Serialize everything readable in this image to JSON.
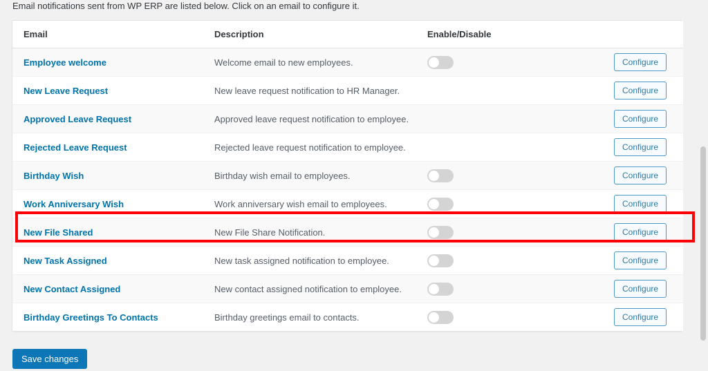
{
  "intro": {
    "text": "Email notifications sent from WP ERP are listed below. Click on an email to configure it."
  },
  "table": {
    "headers": {
      "email": "Email",
      "description": "Description",
      "enable_disable": "Enable/Disable",
      "action": ""
    },
    "rows": [
      {
        "email": "Employee welcome",
        "description": "Welcome email to new employees.",
        "has_toggle": true,
        "toggle_state": "off",
        "action_label": "Configure",
        "highlighted": false
      },
      {
        "email": "New Leave Request",
        "description": "New leave request notification to HR Manager.",
        "has_toggle": false,
        "toggle_state": "",
        "action_label": "Configure",
        "highlighted": false
      },
      {
        "email": "Approved Leave Request",
        "description": "Approved leave request notification to employee.",
        "has_toggle": false,
        "toggle_state": "",
        "action_label": "Configure",
        "highlighted": false
      },
      {
        "email": "Rejected Leave Request",
        "description": "Rejected leave request notification to employee.",
        "has_toggle": false,
        "toggle_state": "",
        "action_label": "Configure",
        "highlighted": false
      },
      {
        "email": "Birthday Wish",
        "description": "Birthday wish email to employees.",
        "has_toggle": true,
        "toggle_state": "off",
        "action_label": "Configure",
        "highlighted": false
      },
      {
        "email": "Work Anniversary Wish",
        "description": "Work anniversary wish email to employees.",
        "has_toggle": true,
        "toggle_state": "off",
        "action_label": "Configure",
        "highlighted": false
      },
      {
        "email": "New File Shared",
        "description": "New File Share Notification.",
        "has_toggle": true,
        "toggle_state": "off",
        "action_label": "Configure",
        "highlighted": true
      },
      {
        "email": "New Task Assigned",
        "description": "New task assigned notification to employee.",
        "has_toggle": true,
        "toggle_state": "off",
        "action_label": "Configure",
        "highlighted": false
      },
      {
        "email": "New Contact Assigned",
        "description": "New contact assigned notification to employee.",
        "has_toggle": true,
        "toggle_state": "off",
        "action_label": "Configure",
        "highlighted": false
      },
      {
        "email": "Birthday Greetings To Contacts",
        "description": "Birthday greetings email to contacts.",
        "has_toggle": true,
        "toggle_state": "off",
        "action_label": "Configure",
        "highlighted": false
      }
    ]
  },
  "footer": {
    "save_label": "Save changes"
  },
  "colors": {
    "link": "#0073aa",
    "primary_button": "#0d76b6",
    "highlight": "#fb0007",
    "toggle_off": "#d4d4d4",
    "page_background": "#f1f1f1"
  }
}
